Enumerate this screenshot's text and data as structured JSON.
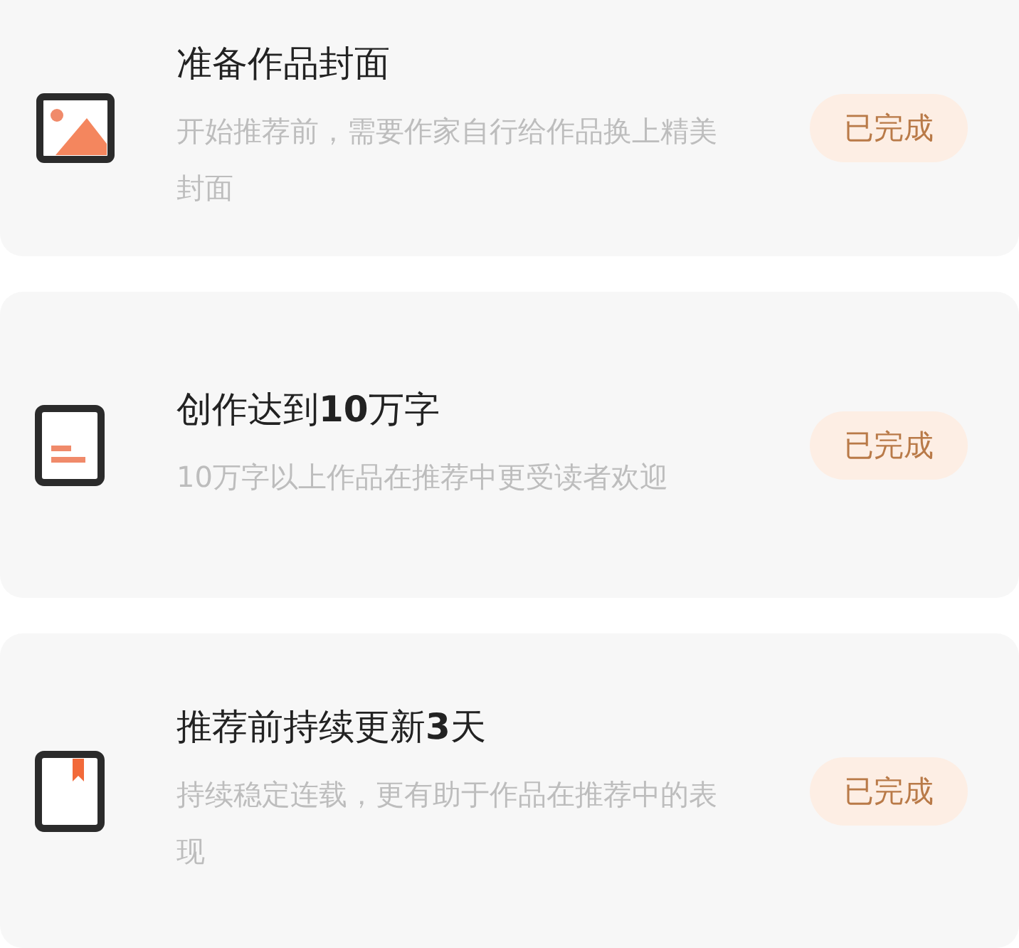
{
  "tasks": [
    {
      "kind": "image",
      "title": "准备作品封面",
      "description": "开始推荐前，需要作家自行给作品换上精美封面",
      "status": "已完成"
    },
    {
      "kind": "document",
      "title": "创作达到**10**万字",
      "description": "10万字以上作品在推荐中更受读者欢迎",
      "status": "已完成"
    },
    {
      "kind": "bookmark",
      "title": "推荐前持续更新**3**天",
      "description": "持续稳定连载，更有助于作品在推荐中的表现",
      "status": "已完成"
    }
  ]
}
